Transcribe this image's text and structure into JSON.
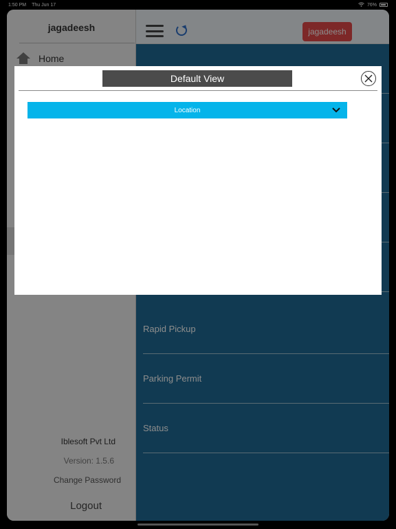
{
  "status_bar": {
    "time": "1:50 PM",
    "date": "Thu Jun 17",
    "battery": "76%"
  },
  "sidebar": {
    "username": "jagadeesh",
    "home_label": "Home",
    "company": "Iblesoft Pvt Ltd",
    "version": "Version: 1.5.6",
    "change_password": "Change Password",
    "logout": "Logout"
  },
  "header": {
    "user_badge": "jagadeesh"
  },
  "menu": {
    "items": [
      {
        "label": ""
      },
      {
        "label": ""
      },
      {
        "label": ""
      },
      {
        "label": ""
      },
      {
        "label": ""
      },
      {
        "label": "Rapid Pickup"
      },
      {
        "label": "Parking Permit"
      },
      {
        "label": "Status"
      }
    ]
  },
  "modal": {
    "title": "Default View",
    "dropdown_value": "Location"
  },
  "colors": {
    "accent": "#05b4ea",
    "main_bg": "#1f6b95",
    "badge": "#e34a4a"
  }
}
